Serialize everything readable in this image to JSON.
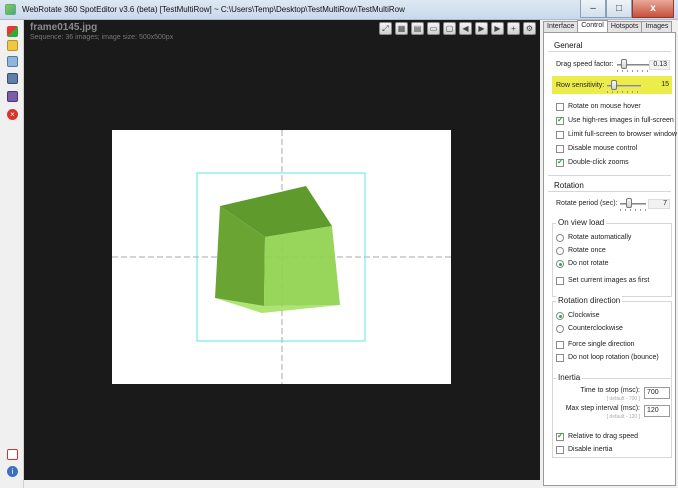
{
  "window": {
    "title": "WebRotate 360 SpotEditor v3.6 (beta) [TestMultiRow] ~ C:\\Users\\Temp\\Desktop\\TestMultiRow\\TestMultiRow",
    "min_label": "–",
    "max_label": "□",
    "close_label": "x"
  },
  "viewer": {
    "filename": "frame0145.jpg",
    "sequence_info": "Sequence: 36 images; image size: 500x500px"
  },
  "colors": {
    "highlight": "#ecec4a",
    "cube_green": "#7cc142",
    "viewer_bg": "#1a1a1a"
  },
  "tabs": [
    {
      "label": "Interface"
    },
    {
      "label": "Control"
    },
    {
      "label": "Hotspots"
    },
    {
      "label": "Images"
    }
  ],
  "general": {
    "title": "General",
    "drag_speed": {
      "label": "Drag speed factor:",
      "value": "0.13",
      "position": 0.15
    },
    "row_sensitivity": {
      "label": "Row sensitivity:",
      "value": "15",
      "position": 0.15
    },
    "checkboxes": [
      {
        "label": "Rotate on mouse hover",
        "checked": false
      },
      {
        "label": "Use high-res images in full-screen",
        "checked": true
      },
      {
        "label": "Limit full-screen to browser window",
        "checked": false
      },
      {
        "label": "Disable mouse control",
        "checked": false
      },
      {
        "label": "Double-click zooms",
        "checked": true
      }
    ]
  },
  "rotation": {
    "title": "Rotation",
    "period": {
      "label": "Rotate period (sec):",
      "value": "7",
      "position": 0.25
    },
    "on_view_load": {
      "title": "On view load",
      "options": [
        {
          "label": "Rotate automatically",
          "selected": false
        },
        {
          "label": "Rotate once",
          "selected": false
        },
        {
          "label": "Do not rotate",
          "selected": true
        }
      ],
      "set_first": {
        "label": "Set current images as first",
        "checked": false
      }
    },
    "direction": {
      "title": "Rotation direction",
      "options": [
        {
          "label": "Clockwise",
          "selected": true
        },
        {
          "label": "Counterclockwise",
          "selected": false
        }
      ],
      "checkboxes": [
        {
          "label": "Force single direction",
          "checked": false
        },
        {
          "label": "Do not loop rotation (bounce)",
          "checked": false
        }
      ]
    }
  },
  "inertia": {
    "title": "Inertia",
    "time_to_stop": {
      "label": "Time to stop (msc):",
      "hint": "[ default - 700 ]",
      "value": "700"
    },
    "max_step": {
      "label": "Max step interval (msc):",
      "hint": "[ default - 120 ]",
      "value": "120"
    },
    "checkboxes": [
      {
        "label": "Relative to drag speed",
        "checked": true
      },
      {
        "label": "Disable inertia",
        "checked": false
      }
    ]
  },
  "icons": {
    "viewer_toolbar": [
      "fit-icon",
      "grid-icon",
      "grid-dense-icon",
      "frame-icon",
      "single-frame-icon",
      "prev-icon",
      "play-icon",
      "next-icon",
      "add-icon",
      "settings-icon"
    ],
    "left_toolbar": [
      "project-icon",
      "open-icon",
      "import-icon",
      "preview-icon",
      "save-icon",
      "close-icon",
      "pdf-icon",
      "info-icon"
    ]
  }
}
